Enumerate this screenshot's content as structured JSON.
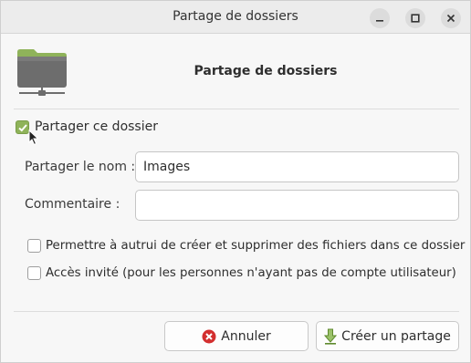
{
  "window": {
    "title": "Partage de dossiers",
    "controls": [
      "minimize-icon",
      "maximize-icon",
      "close-icon"
    ]
  },
  "header": {
    "icon": "folder-network-icon",
    "title": "Partage de dossiers"
  },
  "share": {
    "checkbox_label": "Partager ce dossier",
    "checked": true
  },
  "form": {
    "name_label": "Partager le nom :",
    "name_value": "Images",
    "comment_label": "Commentaire :",
    "comment_value": ""
  },
  "options": [
    {
      "label": "Permettre à autrui de créer et supprimer des fichiers dans ce dossier",
      "checked": false
    },
    {
      "label": "Accès invité (pour les personnes n'ayant pas de compte utilisateur)",
      "checked": false
    }
  ],
  "buttons": {
    "cancel_label": "Annuler",
    "cancel_icon": "cancel-icon",
    "create_label": "Créer un partage",
    "create_icon": "download-arrow-icon"
  },
  "colors": {
    "accent_green": "#8fb35a",
    "cancel_red": "#d32f2f",
    "folder_gray": "#6d6d6d"
  }
}
